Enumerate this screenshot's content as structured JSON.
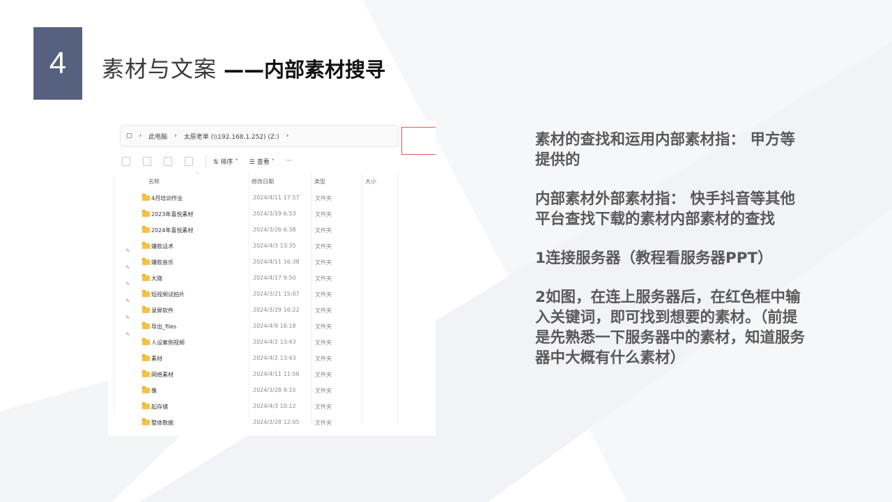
{
  "slide": {
    "number": "4",
    "title_main": "素材与文案",
    "title_sub": "——内部素材搜寻"
  },
  "explorer": {
    "address": {
      "segment_1": "此电脑",
      "segment_2": "太原老单 (\\\\192.168.1.252) (Z:)"
    },
    "toolbar": {
      "sort_label": "⇅ 排序 ˅",
      "view_label": "☰ 查看 ˅",
      "more_label": "···"
    },
    "columns": {
      "name": "名称",
      "date": "修改日期",
      "type": "类型",
      "size": "大小"
    },
    "rows": [
      {
        "name": "4月培训作业",
        "date": "2024/4/11 17:57",
        "type": "文件夹"
      },
      {
        "name": "2023年喜悦素材",
        "date": "2024/3/19 6:53",
        "type": "文件夹"
      },
      {
        "name": "2024年喜悦素材",
        "date": "2024/3/26 6:38",
        "type": "文件夹"
      },
      {
        "name": "爆款话术",
        "date": "2024/4/3 13:35",
        "type": "文件夹"
      },
      {
        "name": "爆款音乐",
        "date": "2024/4/11 16:38",
        "type": "文件夹"
      },
      {
        "name": "大路",
        "date": "2024/4/17 9:50",
        "type": "文件夹"
      },
      {
        "name": "短视频试拍片",
        "date": "2024/3/21 15:07",
        "type": "文件夹"
      },
      {
        "name": "录屏软件",
        "date": "2024/3/29 16:22",
        "type": "文件夹"
      },
      {
        "name": "导出_files",
        "date": "2024/4/9 16:18",
        "type": "文件夹"
      },
      {
        "name": "人设案例视频",
        "date": "2024/4/2 13:43",
        "type": "文件夹"
      },
      {
        "name": "素材",
        "date": "2024/4/2 13:43",
        "type": "文件夹"
      },
      {
        "name": "网络素材",
        "date": "2024/4/11 11:56",
        "type": "文件夹"
      },
      {
        "name": "像",
        "date": "2024/3/28 9:15",
        "type": "文件夹"
      },
      {
        "name": "起存储",
        "date": "2024/4/3 10:12",
        "type": "文件夹"
      },
      {
        "name": "整体数据",
        "date": "2024/3/28 12:05",
        "type": "文件夹"
      }
    ]
  },
  "notes": {
    "p1": "素材的查找和运用内部素材指： 甲方等提供的",
    "p2": "内部素材外部素材指： 快手抖音等其他平台查找下载的素材内部素材的查找",
    "p3": "1连接服务器（教程看服务器PPT）",
    "p4": "2如图，在连上服务器后，在红色框中输入关键词，即可找到想要的素材。（前提是先熟悉一下服务器中的素材，知道服务器中大概有什么素材）"
  }
}
